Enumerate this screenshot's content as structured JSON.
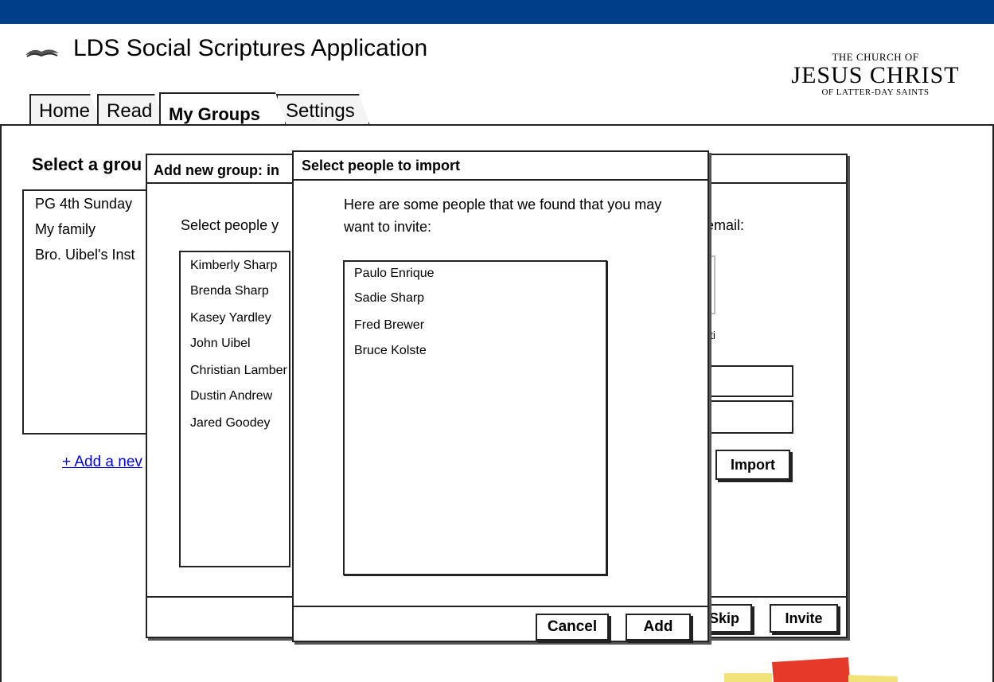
{
  "app": {
    "title": "LDS Social Scriptures Application",
    "logo": {
      "line1": "THE CHURCH OF",
      "line2": "JESUS CHRIST",
      "line3": "OF LATTER-DAY SAINTS"
    },
    "icon": "scripture-book-icon",
    "accent_color": "#003f87"
  },
  "tabs": [
    {
      "label": "Home"
    },
    {
      "label": "Read"
    },
    {
      "label": "My Groups",
      "active": true
    },
    {
      "label": "Settings"
    }
  ],
  "groups": {
    "heading": "Select a grou",
    "items": [
      "PG 4th Sunday",
      "My family",
      "Bro. Uibel's Inst"
    ],
    "add_link": "+ Add a nev"
  },
  "add_group_dialog": {
    "title": "Add new group: in",
    "prompt": "Select people y",
    "email_label": "email:",
    "small_text": "ti",
    "people": [
      "Kimberly Sharp",
      "Brenda Sharp",
      "Kasey Yardley",
      "John Uibel",
      "Christian Lamber",
      "Dustin Andrew",
      "Jared Goodey"
    ],
    "import_label": "Import",
    "skip_label": "Skip",
    "invite_label": "Invite"
  },
  "import_dialog": {
    "title": "Select people to import",
    "intro": "Here are some people that we found that you may want to invite:",
    "people": [
      "Paulo Enrique",
      "Sadie Sharp",
      "Fred Brewer",
      "Bruce Kolste"
    ],
    "cancel_label": "Cancel",
    "add_label": "Add"
  }
}
